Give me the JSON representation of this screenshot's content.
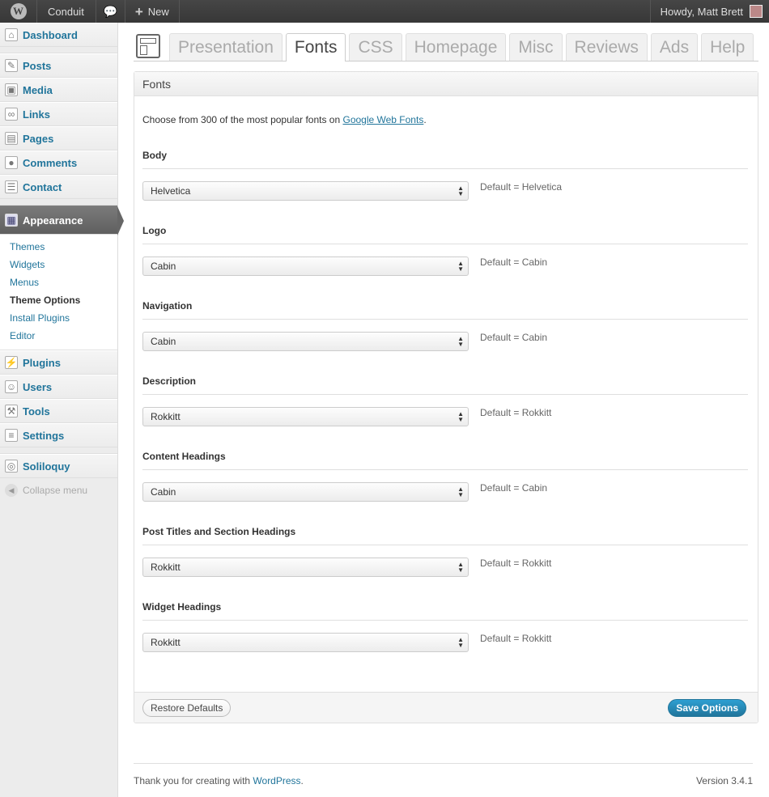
{
  "adminbar": {
    "site_name": "Conduit",
    "new_label": "New",
    "greeting": "Howdy, Matt Brett"
  },
  "sidebar": {
    "items": [
      {
        "label": "Dashboard",
        "icon": "dashboard-icon"
      },
      {
        "label": "Posts",
        "icon": "pushpin-icon"
      },
      {
        "label": "Media",
        "icon": "media-icon"
      },
      {
        "label": "Links",
        "icon": "link-icon"
      },
      {
        "label": "Pages",
        "icon": "pages-icon"
      },
      {
        "label": "Comments",
        "icon": "comment-icon"
      },
      {
        "label": "Contact",
        "icon": "contact-icon"
      },
      {
        "label": "Appearance",
        "icon": "appearance-icon"
      },
      {
        "label": "Plugins",
        "icon": "plugin-icon"
      },
      {
        "label": "Users",
        "icon": "users-icon"
      },
      {
        "label": "Tools",
        "icon": "tools-icon"
      },
      {
        "label": "Settings",
        "icon": "settings-icon"
      },
      {
        "label": "Soliloquy",
        "icon": "soliloquy-icon"
      }
    ],
    "submenu": [
      "Themes",
      "Widgets",
      "Menus",
      "Theme Options",
      "Install Plugins",
      "Editor"
    ],
    "collapse_label": "Collapse menu"
  },
  "tabs": [
    "Presentation",
    "Fonts",
    "CSS",
    "Homepage",
    "Misc",
    "Reviews",
    "Ads",
    "Help"
  ],
  "active_tab": "Fonts",
  "panel": {
    "title": "Fonts",
    "intro_before": "Choose from 300 of the most popular fonts on ",
    "intro_link": "Google Web Fonts",
    "intro_after": ".",
    "fields": [
      {
        "label": "Body",
        "value": "Helvetica",
        "default": "Default = Helvetica"
      },
      {
        "label": "Logo",
        "value": "Cabin",
        "default": "Default = Cabin"
      },
      {
        "label": "Navigation",
        "value": "Cabin",
        "default": "Default = Cabin"
      },
      {
        "label": "Description",
        "value": "Rokkitt",
        "default": "Default = Rokkitt"
      },
      {
        "label": "Content Headings",
        "value": "Cabin",
        "default": "Default = Cabin"
      },
      {
        "label": "Post Titles and Section Headings",
        "value": "Rokkitt",
        "default": "Default = Rokkitt"
      },
      {
        "label": "Widget Headings",
        "value": "Rokkitt",
        "default": "Default = Rokkitt"
      }
    ],
    "restore_label": "Restore Defaults",
    "save_label": "Save Options"
  },
  "footer": {
    "thanks_before": "Thank you for creating with ",
    "thanks_link": "WordPress",
    "thanks_after": ".",
    "version": "Version 3.4.1"
  },
  "colors": {
    "link": "#21759b",
    "admin_bar": "#464646",
    "primary_button": "#21759b"
  }
}
